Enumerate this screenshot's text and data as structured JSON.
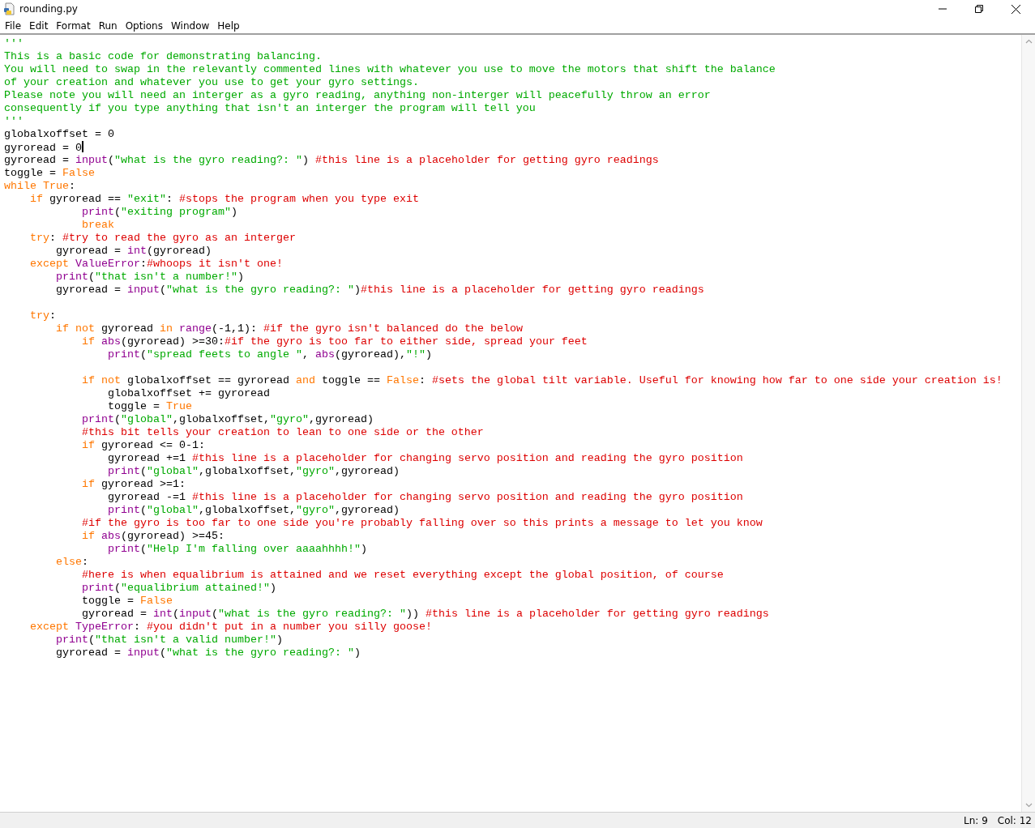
{
  "window": {
    "title": "rounding.py"
  },
  "menu": [
    "File",
    "Edit",
    "Format",
    "Run",
    "Options",
    "Window",
    "Help"
  ],
  "editor": {
    "lines": [
      {
        "kind": "code",
        "tokens": [
          {
            "kind": "string",
            "text": "'''"
          }
        ]
      },
      {
        "kind": "code",
        "tokens": [
          {
            "kind": "string",
            "text": "This is a basic code for demonstrating balancing."
          }
        ]
      },
      {
        "kind": "code",
        "tokens": [
          {
            "kind": "string",
            "text": "You will need to swap in the relevantly commented lines with whatever you use to move the motors that shift the balance"
          }
        ]
      },
      {
        "kind": "code",
        "tokens": [
          {
            "kind": "string",
            "text": "of your creation and whatever you use to get your gyro settings."
          }
        ]
      },
      {
        "kind": "code",
        "tokens": [
          {
            "kind": "string",
            "text": "Please note you will need an interger as a gyro reading, anything non-interger will peacefully throw an error"
          }
        ]
      },
      {
        "kind": "code",
        "tokens": [
          {
            "kind": "string",
            "text": "consequently if you type anything that isn't an interger the program will tell you"
          }
        ]
      },
      {
        "kind": "code",
        "tokens": [
          {
            "kind": "string",
            "text": "'''"
          }
        ]
      },
      {
        "kind": "code",
        "tokens": [
          {
            "kind": "plain",
            "text": "globalxoffset = 0"
          }
        ]
      },
      {
        "kind": "code",
        "cursor": true,
        "tokens": [
          {
            "kind": "plain",
            "text": "gyroread = 0"
          }
        ]
      },
      {
        "kind": "code",
        "tokens": [
          {
            "kind": "plain",
            "text": "gyroread = "
          },
          {
            "kind": "builtin",
            "text": "input"
          },
          {
            "kind": "plain",
            "text": "("
          },
          {
            "kind": "string",
            "text": "\"what is the gyro reading?: \""
          },
          {
            "kind": "plain",
            "text": ") "
          },
          {
            "kind": "comment",
            "text": "#this line is a placeholder for getting gyro readings"
          }
        ]
      },
      {
        "kind": "code",
        "tokens": [
          {
            "kind": "plain",
            "text": "toggle = "
          },
          {
            "kind": "keyword",
            "text": "False"
          }
        ]
      },
      {
        "kind": "code",
        "tokens": [
          {
            "kind": "keyword",
            "text": "while True"
          },
          {
            "kind": "plain",
            "text": ":"
          }
        ]
      },
      {
        "kind": "code",
        "tokens": [
          {
            "kind": "keyword",
            "text": "    if"
          },
          {
            "kind": "plain",
            "text": " gyroread == "
          },
          {
            "kind": "string",
            "text": "\"exit\""
          },
          {
            "kind": "plain",
            "text": ": "
          },
          {
            "kind": "comment",
            "text": "#stops the program when you type exit"
          }
        ]
      },
      {
        "kind": "code",
        "tokens": [
          {
            "kind": "builtin",
            "text": "            print"
          },
          {
            "kind": "plain",
            "text": "("
          },
          {
            "kind": "string",
            "text": "\"exiting program\""
          },
          {
            "kind": "plain",
            "text": ")"
          }
        ]
      },
      {
        "kind": "code",
        "tokens": [
          {
            "kind": "keyword",
            "text": "            break"
          }
        ]
      },
      {
        "kind": "code",
        "tokens": [
          {
            "kind": "keyword",
            "text": "    try"
          },
          {
            "kind": "plain",
            "text": ": "
          },
          {
            "kind": "comment",
            "text": "#try to read the gyro as an interger"
          }
        ]
      },
      {
        "kind": "code",
        "tokens": [
          {
            "kind": "plain",
            "text": "        gyroread = "
          },
          {
            "kind": "builtin",
            "text": "int"
          },
          {
            "kind": "plain",
            "text": "(gyroread)"
          }
        ]
      },
      {
        "kind": "code",
        "tokens": [
          {
            "kind": "keyword",
            "text": "    except "
          },
          {
            "kind": "builtin",
            "text": "ValueError"
          },
          {
            "kind": "plain",
            "text": ":"
          },
          {
            "kind": "comment",
            "text": "#whoops it isn't one!"
          }
        ]
      },
      {
        "kind": "code",
        "tokens": [
          {
            "kind": "builtin",
            "text": "        print"
          },
          {
            "kind": "plain",
            "text": "("
          },
          {
            "kind": "string",
            "text": "\"that isn't a number!\""
          },
          {
            "kind": "plain",
            "text": ")"
          }
        ]
      },
      {
        "kind": "code",
        "tokens": [
          {
            "kind": "plain",
            "text": "        gyroread = "
          },
          {
            "kind": "builtin",
            "text": "input"
          },
          {
            "kind": "plain",
            "text": "("
          },
          {
            "kind": "string",
            "text": "\"what is the gyro reading?: \""
          },
          {
            "kind": "plain",
            "text": ")"
          },
          {
            "kind": "comment",
            "text": "#this line is a placeholder for getting gyro readings"
          }
        ]
      },
      {
        "kind": "blank"
      },
      {
        "kind": "code",
        "tokens": [
          {
            "kind": "keyword",
            "text": "    try"
          },
          {
            "kind": "plain",
            "text": ":"
          }
        ]
      },
      {
        "kind": "code",
        "tokens": [
          {
            "kind": "keyword",
            "text": "        if not"
          },
          {
            "kind": "plain",
            "text": " gyroread "
          },
          {
            "kind": "keyword",
            "text": "in "
          },
          {
            "kind": "builtin",
            "text": "range"
          },
          {
            "kind": "plain",
            "text": "(-1,1): "
          },
          {
            "kind": "comment",
            "text": "#if the gyro isn't balanced do the below"
          }
        ]
      },
      {
        "kind": "code",
        "tokens": [
          {
            "kind": "keyword",
            "text": "            if "
          },
          {
            "kind": "builtin",
            "text": "abs"
          },
          {
            "kind": "plain",
            "text": "(gyroread) >=30:"
          },
          {
            "kind": "comment",
            "text": "#if the gyro is too far to either side, spread your feet"
          }
        ]
      },
      {
        "kind": "code",
        "tokens": [
          {
            "kind": "builtin",
            "text": "                print"
          },
          {
            "kind": "plain",
            "text": "("
          },
          {
            "kind": "string",
            "text": "\"spread feets to angle \""
          },
          {
            "kind": "plain",
            "text": ", "
          },
          {
            "kind": "builtin",
            "text": "abs"
          },
          {
            "kind": "plain",
            "text": "(gyroread),"
          },
          {
            "kind": "string",
            "text": "\"!\""
          },
          {
            "kind": "plain",
            "text": ")"
          }
        ]
      },
      {
        "kind": "blank"
      },
      {
        "kind": "code",
        "tokens": [
          {
            "kind": "keyword",
            "text": "            if not"
          },
          {
            "kind": "plain",
            "text": " globalxoffset == gyroread "
          },
          {
            "kind": "keyword",
            "text": "and"
          },
          {
            "kind": "plain",
            "text": " toggle == "
          },
          {
            "kind": "keyword",
            "text": "False"
          },
          {
            "kind": "plain",
            "text": ": "
          },
          {
            "kind": "comment",
            "text": "#sets the global tilt variable. Useful for knowing how far to one side your creation is!"
          }
        ]
      },
      {
        "kind": "code",
        "tokens": [
          {
            "kind": "plain",
            "text": "                globalxoffset += gyroread"
          }
        ]
      },
      {
        "kind": "code",
        "tokens": [
          {
            "kind": "plain",
            "text": "                toggle = "
          },
          {
            "kind": "keyword",
            "text": "True"
          }
        ]
      },
      {
        "kind": "code",
        "tokens": [
          {
            "kind": "builtin",
            "text": "            print"
          },
          {
            "kind": "plain",
            "text": "("
          },
          {
            "kind": "string",
            "text": "\"global\""
          },
          {
            "kind": "plain",
            "text": ",globalxoffset,"
          },
          {
            "kind": "string",
            "text": "\"gyro\""
          },
          {
            "kind": "plain",
            "text": ",gyroread)"
          }
        ]
      },
      {
        "kind": "code",
        "tokens": [
          {
            "kind": "comment",
            "text": "            #this bit tells your creation to lean to one side or the other"
          }
        ]
      },
      {
        "kind": "code",
        "tokens": [
          {
            "kind": "keyword",
            "text": "            if"
          },
          {
            "kind": "plain",
            "text": " gyroread <= 0-1:"
          }
        ]
      },
      {
        "kind": "code",
        "tokens": [
          {
            "kind": "plain",
            "text": "                gyroread +=1 "
          },
          {
            "kind": "comment",
            "text": "#this line is a placeholder for changing servo position and reading the gyro position"
          }
        ]
      },
      {
        "kind": "code",
        "tokens": [
          {
            "kind": "builtin",
            "text": "                print"
          },
          {
            "kind": "plain",
            "text": "("
          },
          {
            "kind": "string",
            "text": "\"global\""
          },
          {
            "kind": "plain",
            "text": ",globalxoffset,"
          },
          {
            "kind": "string",
            "text": "\"gyro\""
          },
          {
            "kind": "plain",
            "text": ",gyroread)"
          }
        ]
      },
      {
        "kind": "code",
        "tokens": [
          {
            "kind": "keyword",
            "text": "            if"
          },
          {
            "kind": "plain",
            "text": " gyroread >=1:"
          }
        ]
      },
      {
        "kind": "code",
        "tokens": [
          {
            "kind": "plain",
            "text": "                gyroread -=1 "
          },
          {
            "kind": "comment",
            "text": "#this line is a placeholder for changing servo position and reading the gyro position"
          }
        ]
      },
      {
        "kind": "code",
        "tokens": [
          {
            "kind": "builtin",
            "text": "                print"
          },
          {
            "kind": "plain",
            "text": "("
          },
          {
            "kind": "string",
            "text": "\"global\""
          },
          {
            "kind": "plain",
            "text": ",globalxoffset,"
          },
          {
            "kind": "string",
            "text": "\"gyro\""
          },
          {
            "kind": "plain",
            "text": ",gyroread)"
          }
        ]
      },
      {
        "kind": "code",
        "tokens": [
          {
            "kind": "comment",
            "text": "            #if the gyro is too far to one side you're probably falling over so this prints a message to let you know"
          }
        ]
      },
      {
        "kind": "code",
        "tokens": [
          {
            "kind": "keyword",
            "text": "            if "
          },
          {
            "kind": "builtin",
            "text": "abs"
          },
          {
            "kind": "plain",
            "text": "(gyroread) >=45:"
          }
        ]
      },
      {
        "kind": "code",
        "tokens": [
          {
            "kind": "builtin",
            "text": "                print"
          },
          {
            "kind": "plain",
            "text": "("
          },
          {
            "kind": "string",
            "text": "\"Help I'm falling over aaaahhhh!\""
          },
          {
            "kind": "plain",
            "text": ")"
          }
        ]
      },
      {
        "kind": "code",
        "tokens": [
          {
            "kind": "keyword",
            "text": "        else"
          },
          {
            "kind": "plain",
            "text": ":"
          }
        ]
      },
      {
        "kind": "code",
        "tokens": [
          {
            "kind": "comment",
            "text": "            #here is when equalibrium is attained and we reset everything except the global position, of course"
          }
        ]
      },
      {
        "kind": "code",
        "tokens": [
          {
            "kind": "builtin",
            "text": "            print"
          },
          {
            "kind": "plain",
            "text": "("
          },
          {
            "kind": "string",
            "text": "\"equalibrium attained!\""
          },
          {
            "kind": "plain",
            "text": ")"
          }
        ]
      },
      {
        "kind": "code",
        "tokens": [
          {
            "kind": "plain",
            "text": "            toggle = "
          },
          {
            "kind": "keyword",
            "text": "False"
          }
        ]
      },
      {
        "kind": "code",
        "tokens": [
          {
            "kind": "plain",
            "text": "            gyroread = "
          },
          {
            "kind": "builtin",
            "text": "int"
          },
          {
            "kind": "plain",
            "text": "("
          },
          {
            "kind": "builtin",
            "text": "input"
          },
          {
            "kind": "plain",
            "text": "("
          },
          {
            "kind": "string",
            "text": "\"what is the gyro reading?: \""
          },
          {
            "kind": "plain",
            "text": ")) "
          },
          {
            "kind": "comment",
            "text": "#this line is a placeholder for getting gyro readings"
          }
        ]
      },
      {
        "kind": "code",
        "tokens": [
          {
            "kind": "keyword",
            "text": "    except "
          },
          {
            "kind": "builtin",
            "text": "TypeError"
          },
          {
            "kind": "plain",
            "text": ": "
          },
          {
            "kind": "comment",
            "text": "#you didn't put in a number you silly goose!"
          }
        ]
      },
      {
        "kind": "code",
        "tokens": [
          {
            "kind": "builtin",
            "text": "        print"
          },
          {
            "kind": "plain",
            "text": "("
          },
          {
            "kind": "string",
            "text": "\"that isn't a valid number!\""
          },
          {
            "kind": "plain",
            "text": ")"
          }
        ]
      },
      {
        "kind": "code",
        "tokens": [
          {
            "kind": "plain",
            "text": "        gyroread = "
          },
          {
            "kind": "builtin",
            "text": "input"
          },
          {
            "kind": "plain",
            "text": "("
          },
          {
            "kind": "string",
            "text": "\"what is the gyro reading?: \""
          },
          {
            "kind": "plain",
            "text": ")"
          }
        ]
      }
    ]
  },
  "status_bar": {
    "line": "Ln: 9",
    "column": "Col: 12"
  }
}
